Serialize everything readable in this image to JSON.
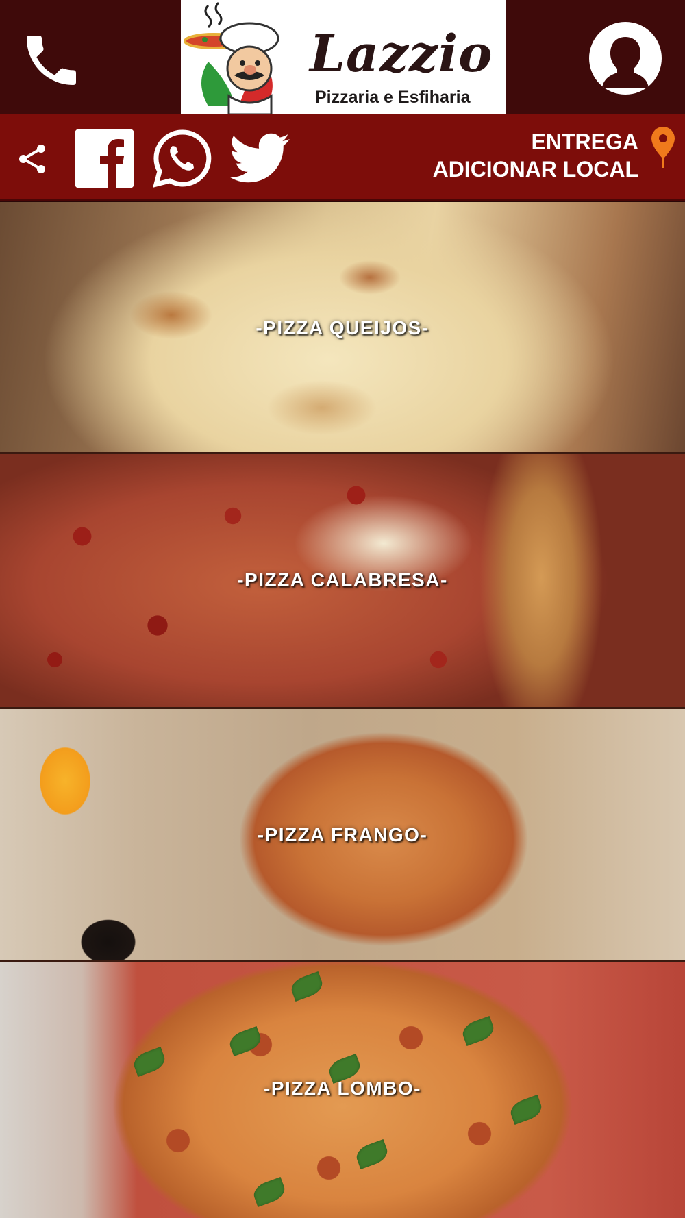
{
  "header": {
    "phone_icon": "phone-icon",
    "logo": {
      "name": "Lazzio",
      "tagline": "Pizzaria e Esfiharia"
    },
    "profile_icon": "user-profile-icon"
  },
  "social_bar": {
    "icons": [
      "share-icon",
      "facebook-icon",
      "whatsapp-icon",
      "twitter-icon"
    ],
    "delivery": {
      "line1": "ENTREGA",
      "line2": "ADICIONAR LOCAL",
      "icon": "location-pin-icon"
    }
  },
  "categories": [
    {
      "label": "-PIZZA QUEIJOS-"
    },
    {
      "label": "-PIZZA CALABRESA-"
    },
    {
      "label": "-PIZZA FRANGO-"
    },
    {
      "label": "-PIZZA LOMBO-"
    }
  ],
  "colors": {
    "header_bg": "#3f0a0a",
    "social_bar_bg": "#7d0d0a",
    "pin": "#f07a1c"
  }
}
